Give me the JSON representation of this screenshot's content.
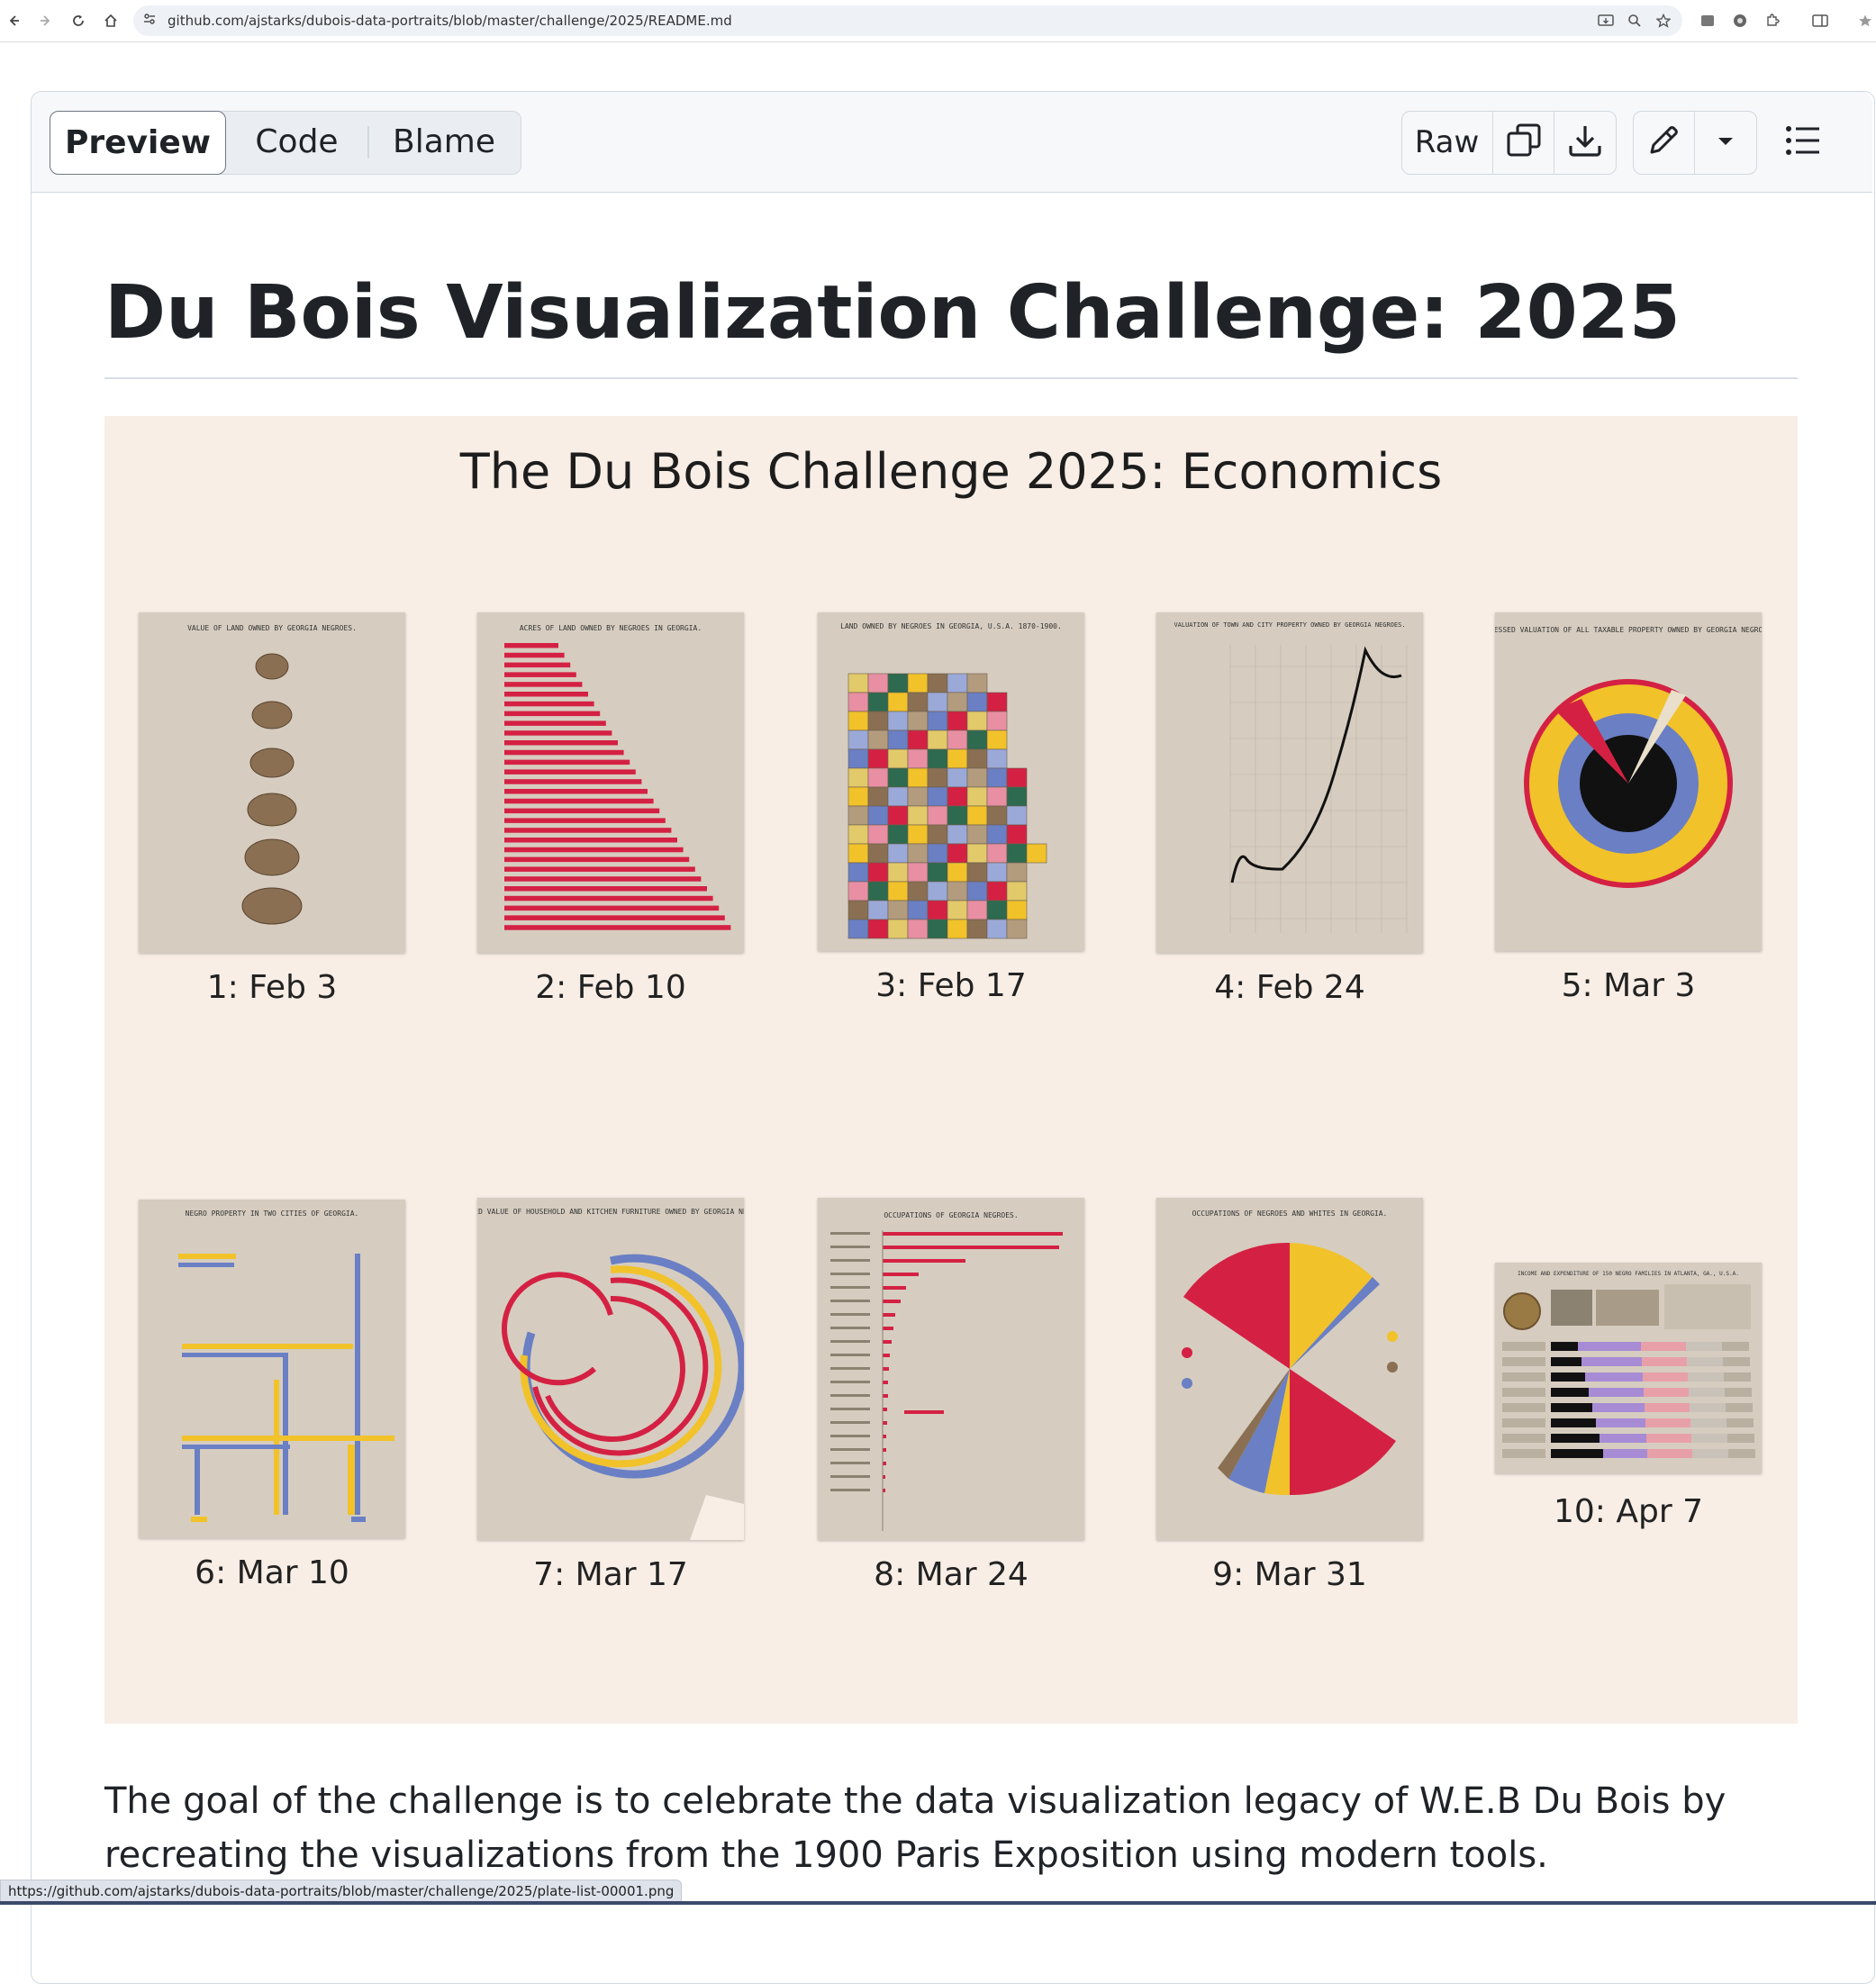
{
  "browser": {
    "url": "github.com/ajstarks/dubois-data-portraits/blob/master/challenge/2025/README.md"
  },
  "toolbar": {
    "tab_preview": "Preview",
    "tab_code": "Code",
    "tab_blame": "Blame",
    "raw_label": "Raw"
  },
  "content": {
    "heading": "Du Bois Visualization Challenge: 2025",
    "banner_title": "The Du Bois Challenge 2025: Economics",
    "plates": [
      {
        "label": "1: Feb 3",
        "caption": "VALUE OF LAND OWNED BY GEORGIA NEGROES."
      },
      {
        "label": "2: Feb 10",
        "caption": "ACRES OF LAND OWNED BY NEGROES IN GEORGIA."
      },
      {
        "label": "3: Feb 17",
        "caption": "LAND OWNED BY NEGROES IN GEORGIA, U.S.A. 1870-1900."
      },
      {
        "label": "4: Feb 24",
        "caption": "VALUATION OF TOWN AND CITY PROPERTY OWNED BY GEORGIA NEGROES."
      },
      {
        "label": "5: Mar 3",
        "caption": "ASSESSED VALUATION OF ALL TAXABLE PROPERTY OWNED BY GEORGIA NEGROES."
      },
      {
        "label": "6: Mar 10",
        "caption": "NEGRO PROPERTY IN TWO CITIES OF GEORGIA."
      },
      {
        "label": "7: Mar 17",
        "caption": "ASSESSED VALUE OF HOUSEHOLD AND KITCHEN FURNITURE OWNED BY GEORGIA NEGROES."
      },
      {
        "label": "8: Mar 24",
        "caption": "OCCUPATIONS OF GEORGIA NEGROES."
      },
      {
        "label": "9: Mar 31",
        "caption": "OCCUPATIONS OF NEGROES AND WHITES IN GEORGIA."
      },
      {
        "label": "10: Apr 7",
        "caption": "INCOME AND EXPENDITURE OF 150 NEGRO FAMILIES IN ATLANTA, GA., U.S.A."
      }
    ],
    "paragraph": "The goal of the challenge is to celebrate the data visualization legacy of W.E.B Du Bois by recreating the visualizations from the 1900 Paris Exposition using modern tools."
  },
  "status_bar": {
    "link": "https://github.com/ajstarks/dubois-data-portraits/blob/master/challenge/2025/plate-list-00001.png"
  },
  "colors": {
    "banner_bg": "#f8eee6",
    "plate_paper": "#d6cdc0",
    "dubois_red": "#d42143",
    "dubois_gold": "#f1c22a",
    "dubois_blue": "#6a7fc4",
    "dubois_black": "#111111",
    "dubois_brown": "#8a6f52"
  }
}
